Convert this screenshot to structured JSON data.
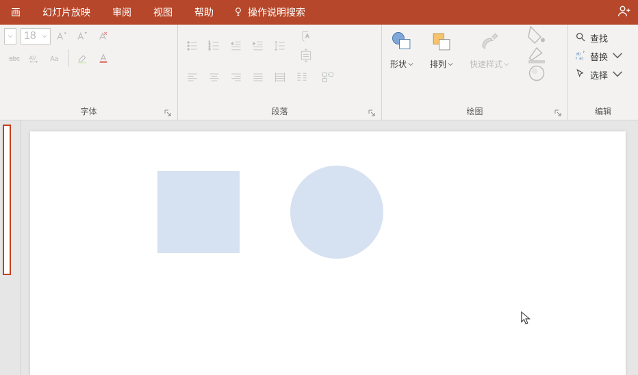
{
  "menu": {
    "tabs": [
      "画",
      "幻灯片放映",
      "审阅",
      "视图",
      "帮助"
    ],
    "tell_me": "操作说明搜索"
  },
  "font": {
    "size": "18",
    "group_label": "字体"
  },
  "paragraph": {
    "group_label": "段落"
  },
  "drawing": {
    "group_label": "绘图",
    "shapes": "形状",
    "arrange": "排列",
    "quick_styles": "快速样式"
  },
  "editing": {
    "group_label": "编辑",
    "find": "查找",
    "replace": "替换",
    "select": "选择"
  }
}
